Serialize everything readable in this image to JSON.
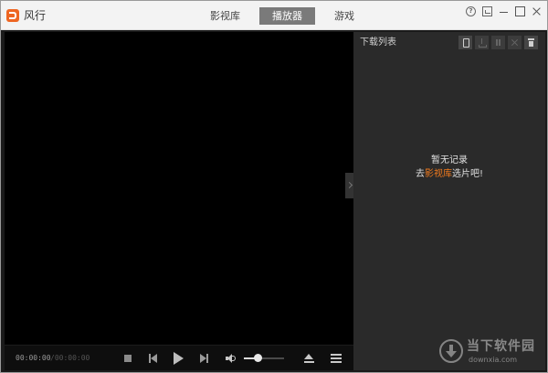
{
  "app": {
    "name": "风行",
    "accent_color": "#ee6622"
  },
  "nav": {
    "tabs": [
      {
        "label": "影视库",
        "active": false
      },
      {
        "label": "播放器",
        "active": true
      },
      {
        "label": "游戏",
        "active": false
      }
    ]
  },
  "window_controls": {
    "help_glyph": "?",
    "icons": [
      "help-icon",
      "mini-mode-icon",
      "minimize-icon",
      "maximize-icon",
      "close-icon"
    ]
  },
  "player": {
    "current_time": "00:00:00",
    "total_time": "/00:00:00",
    "volume_level": 0.35,
    "icons": [
      "stop-icon",
      "prev-icon",
      "play-icon",
      "next-icon",
      "volume-icon",
      "eject-icon",
      "playlist-icon"
    ]
  },
  "panel": {
    "title": "下载列表",
    "tools": [
      "phone-icon",
      "download-icon",
      "pause-icon",
      "cross-icon",
      "trash-icon"
    ],
    "empty_title": "暂无记录",
    "empty_prefix": "去",
    "empty_link": "影视库",
    "empty_suffix": "选片吧!",
    "link_color": "#f07a1e"
  },
  "watermark": {
    "title": "当下软件园",
    "domain": "downxia.com"
  }
}
